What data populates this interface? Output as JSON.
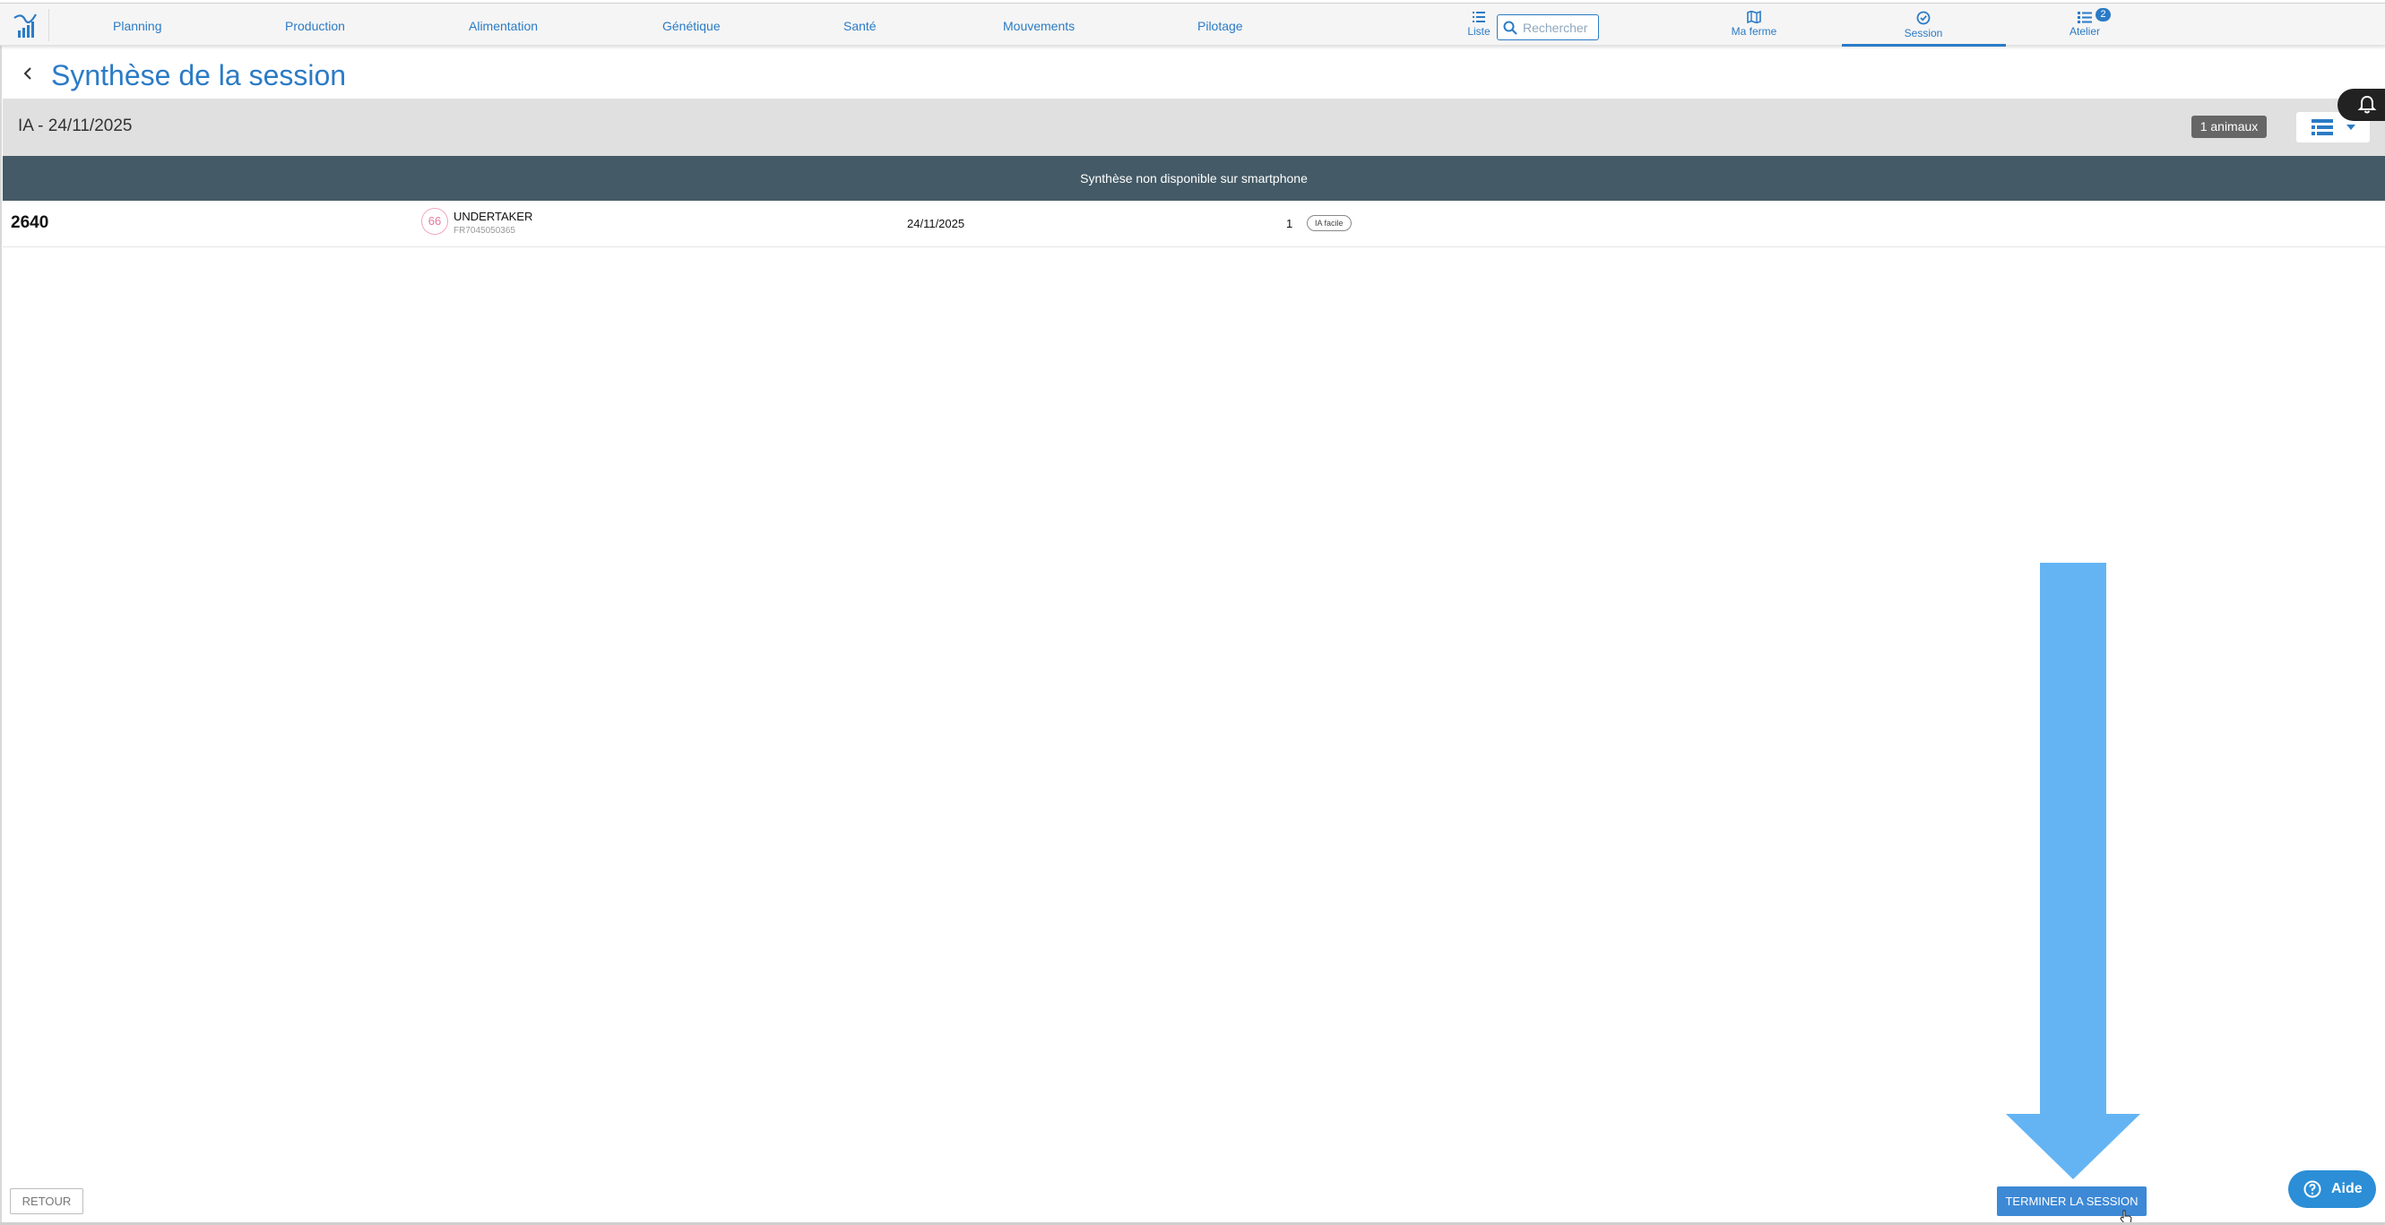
{
  "nav": {
    "items": [
      {
        "label": "Planning"
      },
      {
        "label": "Production"
      },
      {
        "label": "Alimentation"
      },
      {
        "label": "Génétique"
      },
      {
        "label": "Santé"
      },
      {
        "label": "Mouvements"
      },
      {
        "label": "Pilotage"
      }
    ],
    "liste_label": "Liste",
    "search_placeholder": "Rechercher",
    "ma_ferme_label": "Ma ferme",
    "session_label": "Session",
    "atelier_label": "Atelier",
    "atelier_badge": "2",
    "active_item": "Session",
    "accent_color": "#2b7bc6"
  },
  "page": {
    "title": "Synthèse de la session"
  },
  "session": {
    "name": "IA - 24/11/2025",
    "count_badge": "1 animaux",
    "view_icon": "list-view-icon"
  },
  "banner": {
    "text": "Synthèse non disponible sur smartphone",
    "color": "#445a66"
  },
  "rows": [
    {
      "number": "2640",
      "avatar_label": "66",
      "animal_name": "UNDERTAKER",
      "animal_id": "FR7045050365",
      "date": "24/11/2025",
      "count": "1",
      "tag": "IA facile"
    }
  ],
  "footer": {
    "retour_label": "RETOUR",
    "terminer_label": "TERMINER LA SESSION",
    "aide_label": "Aide"
  }
}
